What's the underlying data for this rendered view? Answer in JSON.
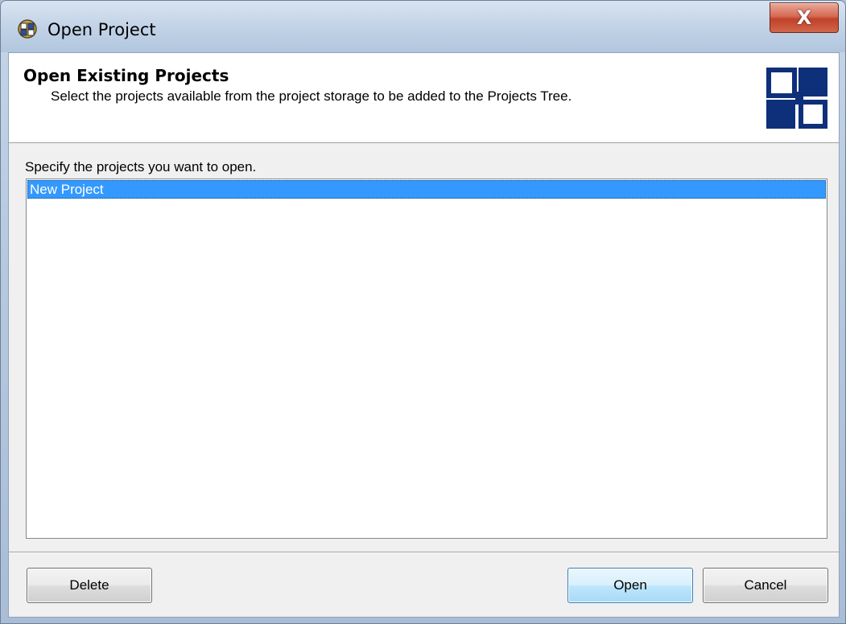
{
  "window": {
    "title": "Open Project",
    "close_label": "X"
  },
  "header": {
    "title": "Open Existing Projects",
    "description": "Select the projects available from the project storage to be added to the Projects Tree."
  },
  "main": {
    "instruction": "Specify the projects you want to open.",
    "projects": [
      {
        "name": "New Project",
        "selected": true
      }
    ]
  },
  "buttons": {
    "delete_label": "Delete",
    "open_label": "Open",
    "cancel_label": "Cancel"
  },
  "colors": {
    "selection": "#3399ff",
    "logo": "#0e2f7a"
  },
  "icons": {
    "title": "project-app-icon",
    "header": "project-blocks-logo-icon"
  }
}
